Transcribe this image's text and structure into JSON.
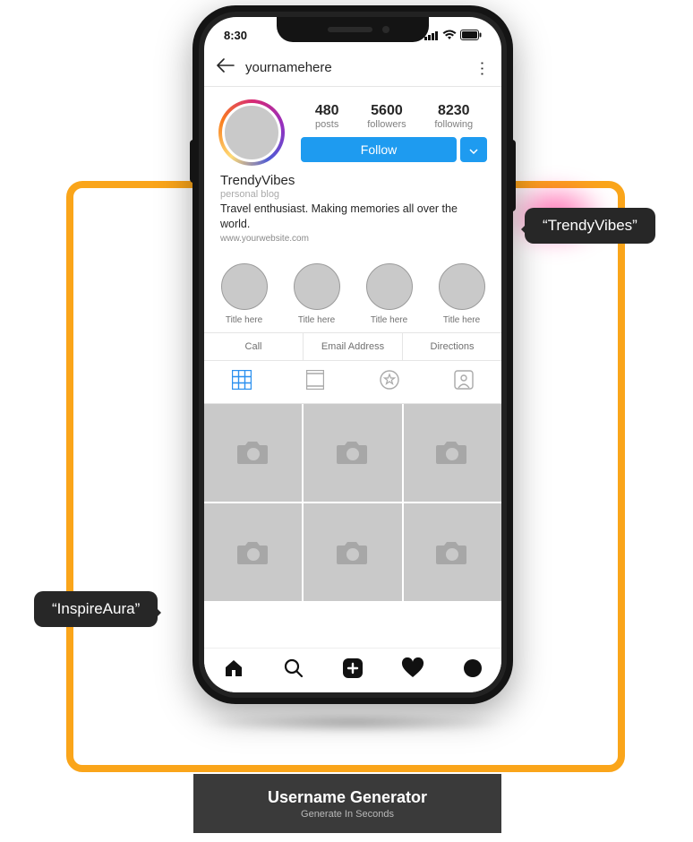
{
  "status": {
    "time": "8:30"
  },
  "header": {
    "username": "yournamehere"
  },
  "stats": {
    "posts_num": "480",
    "posts_label": "posts",
    "followers_num": "5600",
    "followers_label": "followers",
    "following_num": "8230",
    "following_label": "following"
  },
  "follow_label": "Follow",
  "bio": {
    "display_name": "TrendyVibes",
    "category": "personal blog",
    "text": "Travel enthusiast. Making memories all over the world.",
    "website": "www.yourwebsite.com"
  },
  "highlights": [
    "Title here",
    "Title here",
    "Title here",
    "Title here"
  ],
  "contact": {
    "call": "Call",
    "email": "Email Address",
    "directions": "Directions"
  },
  "bubbles": {
    "right": "“TrendyVibes”",
    "left": "“InspireAura”"
  },
  "footer": {
    "title": "Username Generator",
    "subtitle": "Generate In Seconds"
  }
}
